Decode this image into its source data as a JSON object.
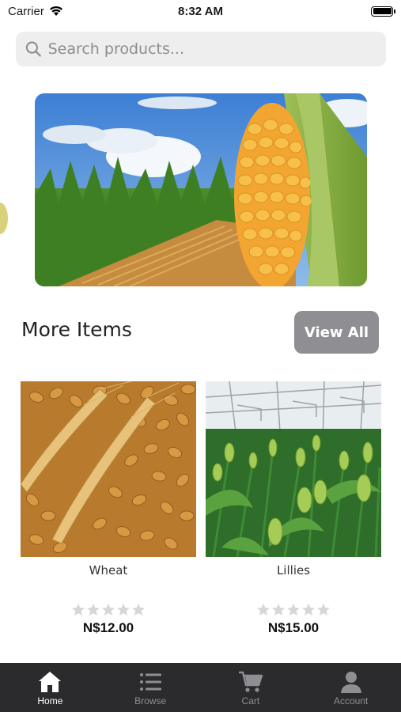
{
  "status_bar": {
    "carrier": "Carrier",
    "time": "8:32 AM"
  },
  "search": {
    "placeholder": "Search products..."
  },
  "section": {
    "title": "More Items",
    "view_all_label": "View All"
  },
  "products": [
    {
      "name": "Wheat",
      "price": "N$12.00",
      "rating": 0,
      "max_rating": 5
    },
    {
      "name": "Lillies",
      "price": "N$15.00",
      "rating": 0,
      "max_rating": 5
    }
  ],
  "tabs": [
    {
      "label": "Home",
      "icon": "home-icon",
      "active": true
    },
    {
      "label": "Browse",
      "icon": "list-icon",
      "active": false
    },
    {
      "label": "Cart",
      "icon": "cart-icon",
      "active": false
    },
    {
      "label": "Account",
      "icon": "account-icon",
      "active": false
    }
  ],
  "colors": {
    "tabbar_bg": "#2b2b2e",
    "tab_active": "#ffffff",
    "tab_inactive": "#8e8e93",
    "button_bg": "#8e8e93",
    "star_empty": "#d6d6d6"
  }
}
